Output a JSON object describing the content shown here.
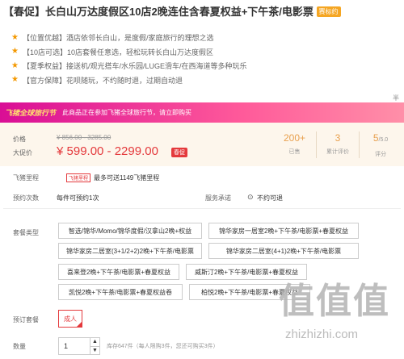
{
  "title": {
    "prefix": "【春促】",
    "text": "长白山万达度假区10店2晚连住含春夏权益+下午茶/电影票",
    "badge": "赛标约"
  },
  "features": [
    "【位置优越】酒店依邻长白山，是度假/家庭旅行的理想之选",
    "【10店可选】10店套餐任意选，轻松玩转长白山万达度假区",
    "【夏季权益】接送机/观光搭车/水乐园/LUGE滑车/在西海道等多种玩乐",
    "【官方保障】花呗随玩，不约随时退，过期自动退"
  ],
  "separator_text": "半报",
  "promo": {
    "logo": "飞猪全球旅行节",
    "text": "此商品正在参加飞猪全球旅行节，请立即购买"
  },
  "price": {
    "label_price": "价格",
    "old_price": "¥ 856.00 - 3285.00",
    "label_promo": "大促价",
    "promo_price": "¥ 599.00 - 2299.00",
    "promo_tag": "春促"
  },
  "stats": [
    {
      "value": "200+",
      "suffix": "",
      "label": "已售"
    },
    {
      "value": "3",
      "suffix": "",
      "label": "累计评价"
    },
    {
      "value": "5",
      "suffix": "/5.0",
      "label": "评分"
    }
  ],
  "miles": {
    "label": "飞猪里程",
    "tag": "飞猪里程",
    "text": "最多可送1149飞猪里程"
  },
  "appointments": {
    "label": "预约次数",
    "value": "每件可预约1次"
  },
  "service": {
    "label": "服务承诺",
    "value": "不约可退"
  },
  "packages": {
    "label": "套餐类型",
    "options": [
      "智选/锦华/Momo/锦华度假/汉拿山2晚+权益",
      "锦华家房一居室2晚+下午茶/电影票+春夏权益",
      "锦华家房二居室(3+1/2+2)2晚+下午茶/电影票",
      "锦华家房二居室(4+1)2晚+下午茶/电影票",
      "喜来登2晚+下午茶/电影票+春夏权益",
      "威斯汀2晚+下午茶/电影票+春夏权益",
      "凯悦2晚+下午茶/电影票+春夏权益卷",
      "柏悦2晚+下午茶/电影票+春夏权益"
    ]
  },
  "booking": {
    "label": "预订套餐",
    "option": "成人"
  },
  "quantity": {
    "label": "数量",
    "value": "1",
    "up": "▲",
    "down": "▼",
    "stock_text": "库存647件（每人限购3件，您还可购买3件）"
  },
  "watermark": {
    "chars": "值值值",
    "url": "zhizhizhi.com"
  }
}
